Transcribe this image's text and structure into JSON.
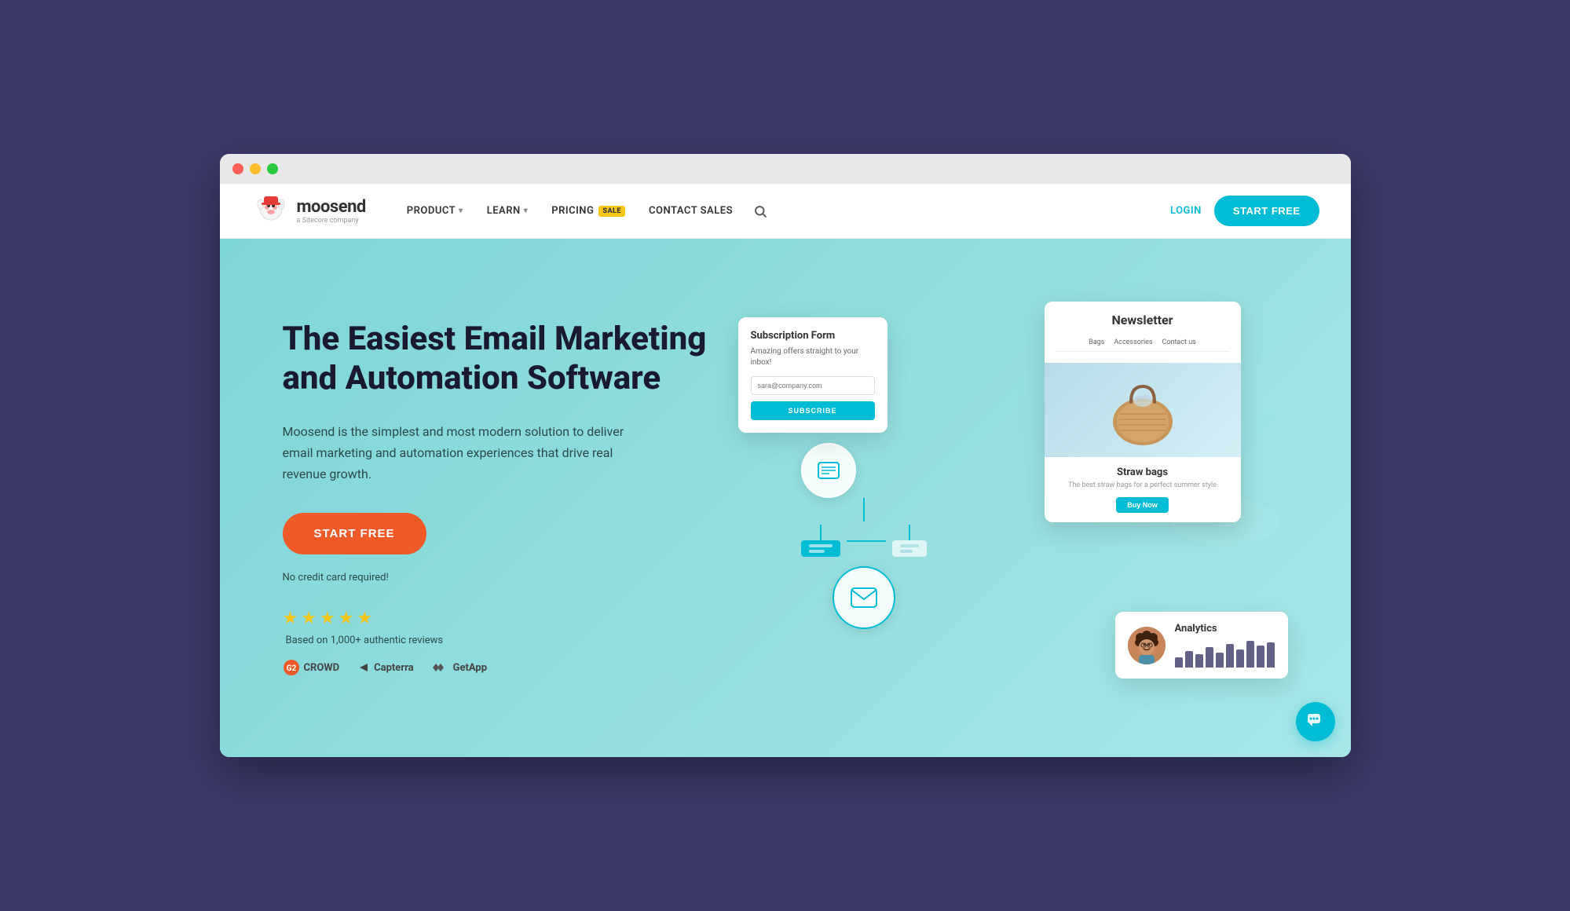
{
  "browser": {
    "traffic_lights": [
      "red",
      "yellow",
      "green"
    ]
  },
  "navbar": {
    "logo_name": "moosend",
    "logo_tagline": "a Sitecore company",
    "nav_items": [
      {
        "label": "PRODUCT",
        "has_dropdown": true
      },
      {
        "label": "LEARN",
        "has_dropdown": true
      },
      {
        "label": "PRICING",
        "has_dropdown": false,
        "has_sale": true
      },
      {
        "label": "CONTACT SALES",
        "has_dropdown": false
      }
    ],
    "sale_badge": "SALE",
    "login_label": "LOGIN",
    "start_free_label": "START FREE"
  },
  "hero": {
    "title": "The Easiest Email Marketing and Automation Software",
    "description": "Moosend is the simplest and most modern solution to deliver email marketing and automation experiences that drive real revenue growth.",
    "cta_label": "START FREE",
    "no_credit_text": "No credit card required!",
    "review_text": "Based on 1,000+ authentic reviews",
    "stars": [
      "★",
      "★",
      "★",
      "★",
      "★"
    ],
    "review_logos": [
      {
        "name": "G2 CROWD",
        "symbol": "G2"
      },
      {
        "name": "Capterra",
        "symbol": "▶"
      },
      {
        "name": "GetApp",
        "symbol": "⋙"
      }
    ]
  },
  "sub_form": {
    "title": "Subscription Form",
    "description": "Amazing offers straight to your inbox!",
    "input_placeholder": "sara@company.com",
    "button_label": "SUBSCRIBE"
  },
  "newsletter": {
    "title": "Newsletter",
    "nav_items": [
      "Bags",
      "Accessories",
      "Contact us"
    ],
    "product_name": "Straw bags",
    "product_desc": "The best straw bags for a perfect summer style",
    "buy_btn": "Buy Now"
  },
  "analytics": {
    "title": "Analytics",
    "bars": [
      30,
      50,
      40,
      60,
      45,
      70,
      55,
      80,
      65,
      75
    ]
  },
  "chat_button": {
    "icon": "🐄"
  }
}
